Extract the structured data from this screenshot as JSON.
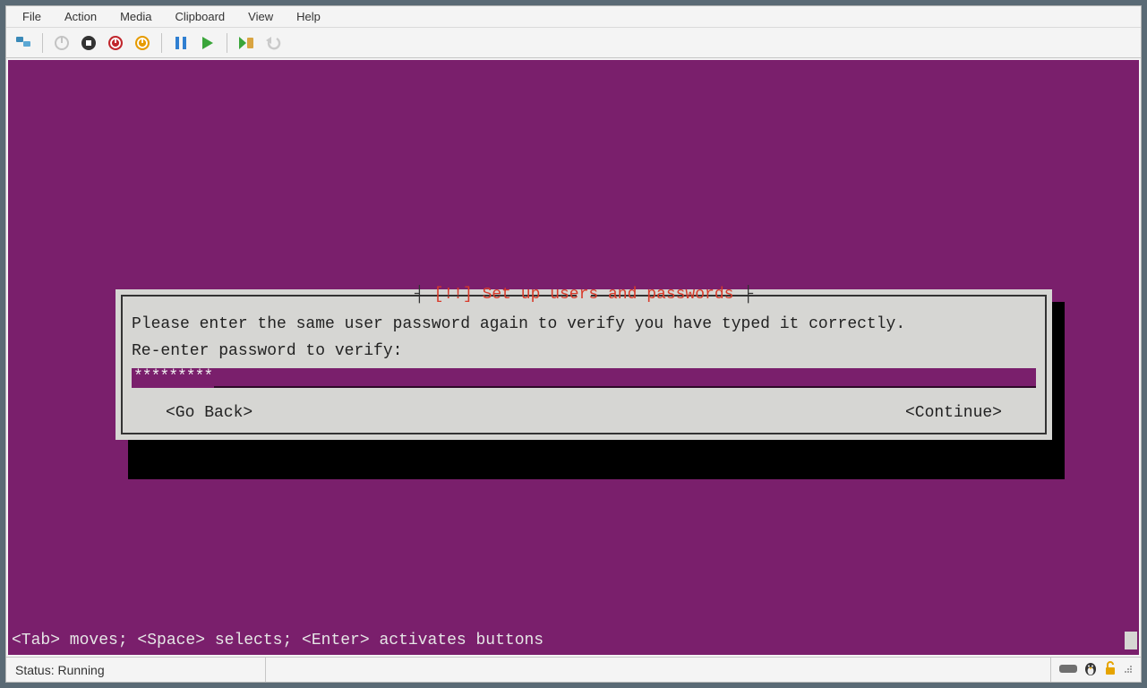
{
  "menubar": {
    "file": "File",
    "action": "Action",
    "media": "Media",
    "clipboard": "Clipboard",
    "view": "View",
    "help": "Help"
  },
  "toolbar_icons": {
    "connect": "connect-icon",
    "power_menu": "power-menu-icon",
    "stop": "stop-icon",
    "shutdown": "shutdown-icon",
    "restart": "restart-icon",
    "pause": "pause-icon",
    "start": "start-icon",
    "checkpoint": "checkpoint-icon",
    "revert": "revert-icon"
  },
  "installer": {
    "title_brackets_open": "┤ ",
    "title_bangs": "[!!]",
    "title_text": " Set up users and passwords ",
    "title_brackets_close": " ├",
    "instruction": "Please enter the same user password again to verify you have typed it correctly.",
    "label": "Re-enter password to verify:",
    "password_masked": "*********",
    "go_back": "<Go Back>",
    "continue": "<Continue>"
  },
  "hint": "<Tab> moves; <Space> selects; <Enter> activates buttons",
  "statusbar": {
    "status": "Status: Running"
  }
}
